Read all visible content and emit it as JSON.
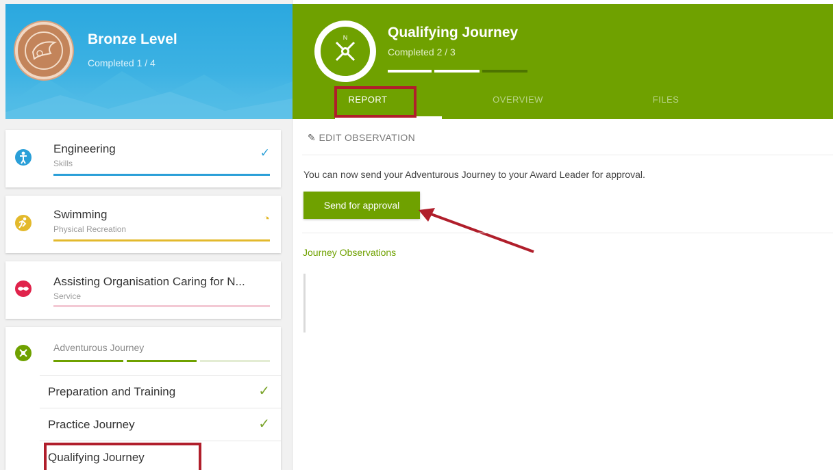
{
  "level": {
    "title": "Bronze Level",
    "completed": "Completed 1 / 4"
  },
  "sections": [
    {
      "title": "Engineering",
      "subtitle": "Skills",
      "status": "✓",
      "color": "#2a9fd8"
    },
    {
      "title": "Swimming",
      "subtitle": "Physical Recreation",
      "status": "◔",
      "color": "#e3b92c"
    },
    {
      "title": "Assisting Organisation Caring for N...",
      "subtitle": "Service",
      "status": "",
      "color": "#e0234b"
    },
    {
      "title": "Adventurous Journey",
      "subtitle": "",
      "status": "",
      "color": "#6fa100"
    }
  ],
  "journey_items": [
    {
      "label": "Preparation and Training",
      "status": "✓"
    },
    {
      "label": "Practice Journey",
      "status": "✓"
    },
    {
      "label": "Qualifying Journey",
      "status": ""
    }
  ],
  "header": {
    "title": "Qualifying Journey",
    "completed": "Completed 2 / 3"
  },
  "tabs": [
    "REPORT",
    "OVERVIEW",
    "FILES"
  ],
  "content": {
    "edit_label": "EDIT OBSERVATION",
    "message": "You can now send your Adventurous Journey to your Award Leader for approval.",
    "send_button": "Send for approval",
    "observations_title": "Journey Observations"
  },
  "colors": {
    "green": "#6fa100",
    "blue": "#2ba8df",
    "annotation_red": "#b01e2b"
  }
}
